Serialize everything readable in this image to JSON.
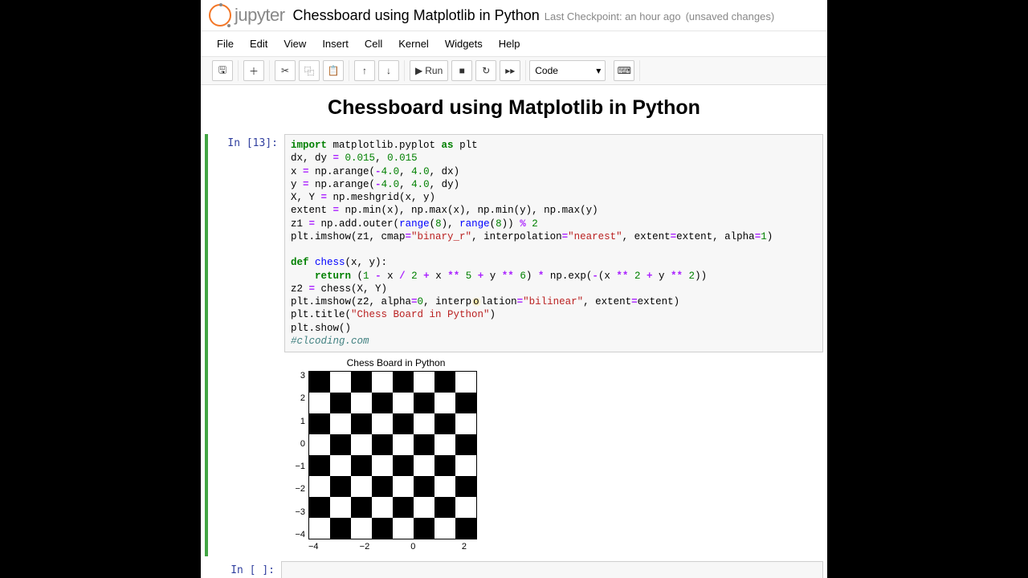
{
  "header": {
    "logo_text": "jupyter",
    "nb_title": "Chessboard using Matplotlib in Python",
    "checkpoint": "Last Checkpoint: an hour ago",
    "unsaved": "(unsaved changes)"
  },
  "menu": [
    "File",
    "Edit",
    "View",
    "Insert",
    "Cell",
    "Kernel",
    "Widgets",
    "Help"
  ],
  "toolbar": {
    "run_label": "Run",
    "celltype": "Code"
  },
  "markdown_heading": "Chessboard using Matplotlib in Python",
  "cell1": {
    "prompt": "In [13]:",
    "code_tokens": [
      [
        {
          "c": "kw",
          "t": "import"
        },
        {
          "t": " matplotlib.pyplot "
        },
        {
          "c": "kw",
          "t": "as"
        },
        {
          "t": " plt"
        }
      ],
      [
        {
          "t": "dx, dy "
        },
        {
          "c": "op",
          "t": "="
        },
        {
          "t": " "
        },
        {
          "c": "num",
          "t": "0.015"
        },
        {
          "t": ", "
        },
        {
          "c": "num",
          "t": "0.015"
        }
      ],
      [
        {
          "t": "x "
        },
        {
          "c": "op",
          "t": "="
        },
        {
          "t": " np.arange("
        },
        {
          "c": "op",
          "t": "-"
        },
        {
          "c": "num",
          "t": "4.0"
        },
        {
          "t": ", "
        },
        {
          "c": "num",
          "t": "4.0"
        },
        {
          "t": ", dx)"
        }
      ],
      [
        {
          "t": "y "
        },
        {
          "c": "op",
          "t": "="
        },
        {
          "t": " np.arange("
        },
        {
          "c": "op",
          "t": "-"
        },
        {
          "c": "num",
          "t": "4.0"
        },
        {
          "t": ", "
        },
        {
          "c": "num",
          "t": "4.0"
        },
        {
          "t": ", dy)"
        }
      ],
      [
        {
          "t": "X, Y "
        },
        {
          "c": "op",
          "t": "="
        },
        {
          "t": " np.meshgrid(x, y)"
        }
      ],
      [
        {
          "t": "extent "
        },
        {
          "c": "op",
          "t": "="
        },
        {
          "t": " np.min(x), np.max(x), np.min(y), np.max(y)"
        }
      ],
      [
        {
          "t": "z1 "
        },
        {
          "c": "op",
          "t": "="
        },
        {
          "t": " np.add.outer("
        },
        {
          "c": "def",
          "t": "range"
        },
        {
          "t": "("
        },
        {
          "c": "num",
          "t": "8"
        },
        {
          "t": "), "
        },
        {
          "c": "def",
          "t": "range"
        },
        {
          "t": "("
        },
        {
          "c": "num",
          "t": "8"
        },
        {
          "t": ")) "
        },
        {
          "c": "op",
          "t": "%"
        },
        {
          "t": " "
        },
        {
          "c": "num",
          "t": "2"
        }
      ],
      [
        {
          "t": "plt.imshow(z1, cmap"
        },
        {
          "c": "op",
          "t": "="
        },
        {
          "c": "str",
          "t": "\"binary_r\""
        },
        {
          "t": ", interpolation"
        },
        {
          "c": "op",
          "t": "="
        },
        {
          "c": "str",
          "t": "\"nearest\""
        },
        {
          "t": ", extent"
        },
        {
          "c": "op",
          "t": "="
        },
        {
          "t": "extent, alpha"
        },
        {
          "c": "op",
          "t": "="
        },
        {
          "c": "num",
          "t": "1"
        },
        {
          "t": ")"
        }
      ],
      [
        {
          "t": ""
        }
      ],
      [
        {
          "c": "kw",
          "t": "def"
        },
        {
          "t": " "
        },
        {
          "c": "def",
          "t": "chess"
        },
        {
          "t": "(x, y):"
        }
      ],
      [
        {
          "t": "    "
        },
        {
          "c": "kw",
          "t": "return"
        },
        {
          "t": " ("
        },
        {
          "c": "num",
          "t": "1"
        },
        {
          "t": " "
        },
        {
          "c": "op",
          "t": "-"
        },
        {
          "t": " x "
        },
        {
          "c": "op",
          "t": "/"
        },
        {
          "t": " "
        },
        {
          "c": "num",
          "t": "2"
        },
        {
          "t": " "
        },
        {
          "c": "op",
          "t": "+"
        },
        {
          "t": " x "
        },
        {
          "c": "op",
          "t": "**"
        },
        {
          "t": " "
        },
        {
          "c": "num",
          "t": "5"
        },
        {
          "t": " "
        },
        {
          "c": "op",
          "t": "+"
        },
        {
          "t": " y "
        },
        {
          "c": "op",
          "t": "**"
        },
        {
          "t": " "
        },
        {
          "c": "num",
          "t": "6"
        },
        {
          "t": ") "
        },
        {
          "c": "op",
          "t": "*"
        },
        {
          "t": " np.exp("
        },
        {
          "c": "op",
          "t": "-"
        },
        {
          "t": "(x "
        },
        {
          "c": "op",
          "t": "**"
        },
        {
          "t": " "
        },
        {
          "c": "num",
          "t": "2"
        },
        {
          "t": " "
        },
        {
          "c": "op",
          "t": "+"
        },
        {
          "t": " y "
        },
        {
          "c": "op",
          "t": "**"
        },
        {
          "t": " "
        },
        {
          "c": "num",
          "t": "2"
        },
        {
          "t": "))"
        }
      ],
      [
        {
          "t": "z2 "
        },
        {
          "c": "op",
          "t": "="
        },
        {
          "t": " chess(X, Y)"
        }
      ],
      [
        {
          "t": "plt.imshow(z2, alpha"
        },
        {
          "c": "op",
          "t": "="
        },
        {
          "c": "num",
          "t": "0"
        },
        {
          "t": ", interp"
        },
        {
          "c": "hl",
          "t": "o"
        },
        {
          "t": "lation"
        },
        {
          "c": "op",
          "t": "="
        },
        {
          "c": "str",
          "t": "\"bilinear\""
        },
        {
          "t": ", extent"
        },
        {
          "c": "op",
          "t": "="
        },
        {
          "t": "extent)"
        }
      ],
      [
        {
          "t": "plt.title("
        },
        {
          "c": "str",
          "t": "\"Chess Board in Python\""
        },
        {
          "t": ")"
        }
      ],
      [
        {
          "t": "plt.show()"
        }
      ],
      [
        {
          "c": "com",
          "t": "#clcoding.com"
        }
      ]
    ]
  },
  "chart_data": {
    "type": "heatmap",
    "title": "Chess Board in Python",
    "xlabel": "",
    "ylabel": "",
    "xlim": [
      -4,
      4
    ],
    "ylim": [
      -4,
      4
    ],
    "xticks": [
      -4,
      -2,
      0,
      2
    ],
    "yticks": [
      3,
      2,
      1,
      0,
      -1,
      -2,
      -3,
      -4
    ],
    "grid_size": [
      8,
      8
    ],
    "cmap": "binary_r",
    "values_pattern": "(row + col) % 2"
  },
  "cell2": {
    "prompt": "In [ ]:"
  }
}
